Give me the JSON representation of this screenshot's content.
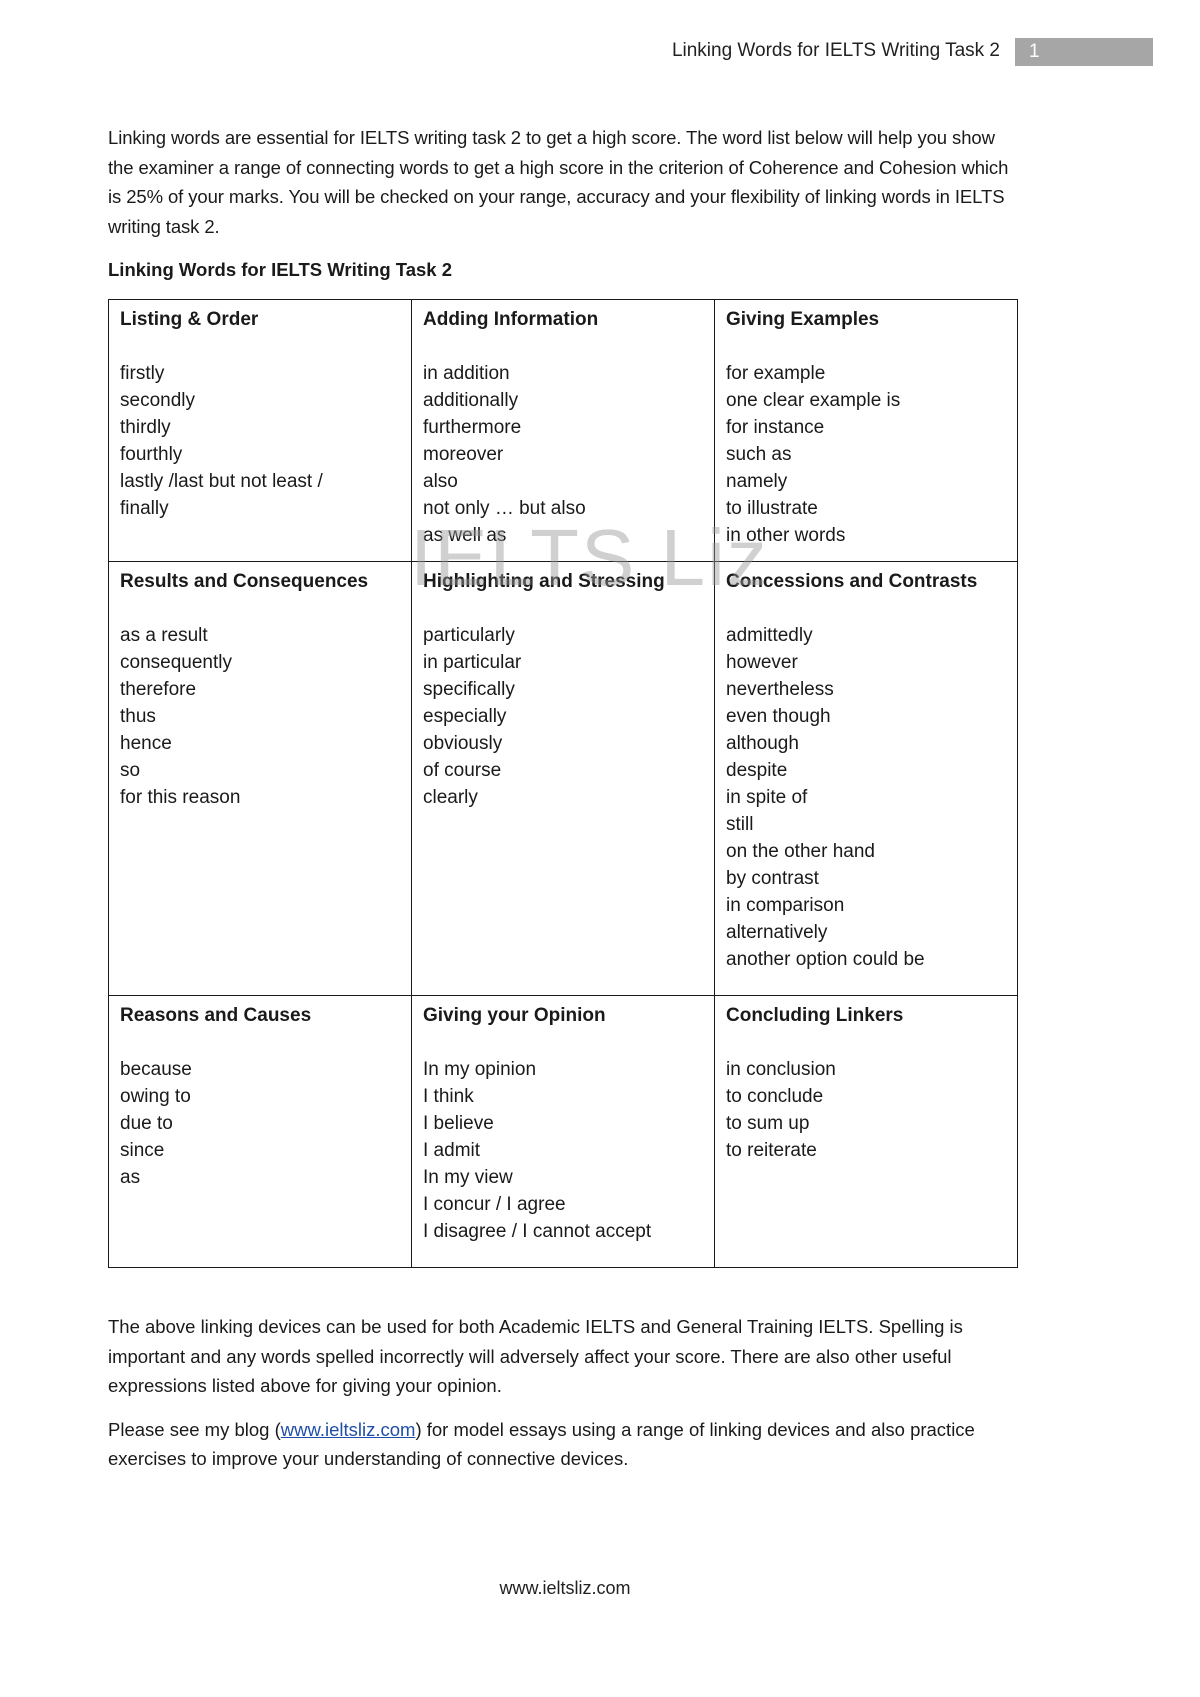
{
  "header": {
    "title": "Linking Words for IELTS Writing Task 2",
    "page_number": "1"
  },
  "intro": "Linking words are essential for IELTS writing task 2 to get a high score. The word list below will help you show the examiner a range of connecting words to get a high score in the criterion of Coherence and Cohesion which is 25% of your marks. You will be checked on your range, accuracy and your flexibility of linking words in IELTS writing task 2.",
  "section_title": "Linking Words for IELTS Writing Task 2",
  "table": {
    "rows": [
      [
        {
          "heading": "Listing & Order",
          "items": [
            "firstly",
            "secondly",
            "thirdly",
            "fourthly",
            "lastly /last but not least /",
            "finally"
          ]
        },
        {
          "heading": "Adding Information",
          "items": [
            "in addition",
            "additionally",
            "furthermore",
            "moreover",
            "also",
            "not only … but also",
            "as well as"
          ]
        },
        {
          "heading": "Giving Examples",
          "items": [
            "for example",
            "one clear example is",
            "for instance",
            "such as",
            "namely",
            "to illustrate",
            "in other words"
          ]
        }
      ],
      [
        {
          "heading": "Results and Consequences",
          "items": [
            "as a result",
            "consequently",
            "therefore",
            "thus",
            "hence",
            "so",
            "for this reason"
          ]
        },
        {
          "heading": "Highlighting and Stressing",
          "items": [
            "particularly",
            "in particular",
            "specifically",
            "especially",
            "obviously",
            "of course",
            "clearly"
          ]
        },
        {
          "heading": "Concessions and Contrasts",
          "items": [
            "admittedly",
            "however",
            "nevertheless",
            "even though",
            "although",
            "despite",
            "in spite of",
            "still",
            "on the other hand",
            "by contrast",
            "in comparison",
            "alternatively",
            "another option could be"
          ]
        }
      ],
      [
        {
          "heading": "Reasons and Causes",
          "items": [
            "because",
            "owing to",
            "due to",
            "since",
            "as"
          ]
        },
        {
          "heading": "Giving your Opinion",
          "items": [
            "In my opinion",
            "I think",
            "I believe",
            "I admit",
            "In my view",
            "I concur  / I agree",
            "I disagree / I cannot accept"
          ]
        },
        {
          "heading": "Concluding Linkers",
          "items": [
            "in conclusion",
            "to conclude",
            "to sum up",
            "to reiterate"
          ]
        }
      ]
    ]
  },
  "watermark": "IELTS Liz",
  "outro": "The above linking devices can be used for both Academic IELTS and General Training IELTS. Spelling is important and any words spelled incorrectly will adversely affect your score. There are also other useful expressions listed above for giving your opinion.",
  "blog": {
    "before": "Please see my blog (",
    "link_text": "www.ieltsliz.com",
    "after": ") for model essays using a range of linking devices and also practice exercises to improve your understanding of connective devices."
  },
  "footer": "www.ieltsliz.com",
  "colors": {
    "page_number_bg": "#a6a6a6",
    "link": "#1f4ea8"
  }
}
